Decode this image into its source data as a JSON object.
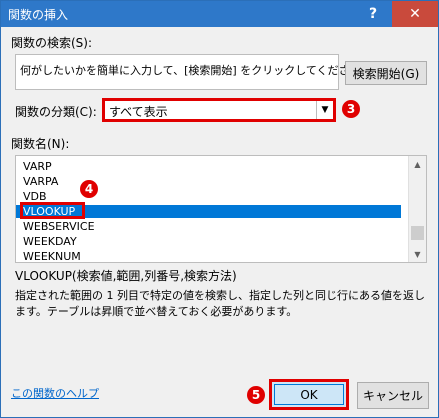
{
  "window": {
    "title": "関数の挿入",
    "help_glyph": "?",
    "close_glyph": "✕"
  },
  "search": {
    "label": "関数の検索(S):",
    "description": "何がしたいかを簡単に入力して、[検索開始] をクリックしてください。",
    "start_button": "検索開始(G)"
  },
  "category": {
    "label": "関数の分類(C):",
    "selected": "すべて表示",
    "arrow": "▼"
  },
  "function_list": {
    "label": "関数名(N):",
    "items": [
      "VARP",
      "VARPA",
      "VDB",
      "VLOOKUP",
      "WEBSERVICE",
      "WEEKDAY",
      "WEEKNUM"
    ],
    "selected_index": 3
  },
  "selected_function": {
    "signature": "VLOOKUP(検索値,範囲,列番号,検索方法)",
    "description": "指定された範囲の 1 列目で特定の値を検索し、指定した列と同じ行にある値を返します。テーブルは昇順で並べ替えておく必要があります。"
  },
  "footer": {
    "help_link": "この関数のヘルプ",
    "ok_button": "OK",
    "cancel_button": "キャンセル"
  },
  "annotations": {
    "badge_3": "❸",
    "badge_4": "❹",
    "badge_5": "❺"
  },
  "colors": {
    "titlebar": "#2e78c9",
    "highlight": "#e00000",
    "selection": "#0078d7"
  }
}
